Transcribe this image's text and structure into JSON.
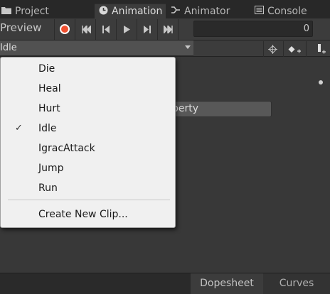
{
  "tabs": [
    {
      "label": "Project",
      "icon": "folder-icon"
    },
    {
      "label": "Animation",
      "icon": "animation-clock-icon"
    },
    {
      "label": "Animator",
      "icon": "animator-icon"
    },
    {
      "label": "Console",
      "icon": "console-icon"
    }
  ],
  "toolbar": {
    "preview_label": "Preview",
    "record_icon": "record-icon",
    "controls": [
      {
        "icon": "first-keyframe-icon",
        "glyph": "⏮"
      },
      {
        "icon": "prev-keyframe-icon",
        "glyph": "⏴"
      },
      {
        "icon": "play-icon",
        "glyph": "▶"
      },
      {
        "icon": "next-keyframe-icon",
        "glyph": "⏵"
      },
      {
        "icon": "last-keyframe-icon",
        "glyph": "⏭"
      }
    ],
    "time_value": "0"
  },
  "clip_selector": {
    "selected": "Idle"
  },
  "add_property_partial": "perty",
  "dropdown": {
    "items": [
      {
        "label": "Die",
        "checked": false
      },
      {
        "label": "Heal",
        "checked": false
      },
      {
        "label": "Hurt",
        "checked": false
      },
      {
        "label": "Idle",
        "checked": true
      },
      {
        "label": "IgracAttack",
        "checked": false
      },
      {
        "label": "Jump",
        "checked": false
      },
      {
        "label": "Run",
        "checked": false
      }
    ],
    "create_label": "Create New Clip...",
    "check_glyph": "✓"
  },
  "bottom_tabs": {
    "dopesheet": "Dopesheet",
    "curves": "Curves"
  },
  "colors": {
    "record": "#f05030",
    "panel": "#383838",
    "menu_bg": "#f0f0f0"
  }
}
